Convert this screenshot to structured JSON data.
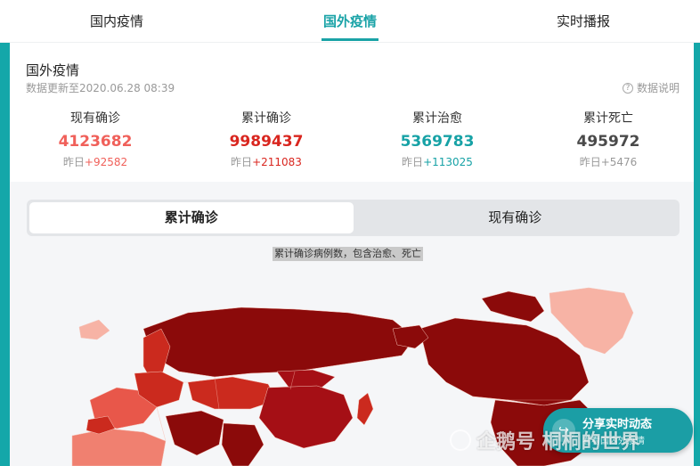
{
  "tabs": [
    {
      "label": "国内疫情",
      "active": false
    },
    {
      "label": "国外疫情",
      "active": true
    },
    {
      "label": "实时播报",
      "active": false
    }
  ],
  "header": {
    "title": "国外疫情",
    "update": "数据更新至2020.06.28 08:39",
    "help_label": "数据说明",
    "help_icon": "question-circle-icon"
  },
  "stats": [
    {
      "label": "现有确诊",
      "value": "4123682",
      "delta_prefix": "昨日",
      "delta": "+92582",
      "color": "#f0605a"
    },
    {
      "label": "累计确诊",
      "value": "9989437",
      "delta_prefix": "昨日",
      "delta": "+211083",
      "color": "#d9261f"
    },
    {
      "label": "累计治愈",
      "value": "5369783",
      "delta_prefix": "昨日",
      "delta": "+113025",
      "color": "#17a2a6"
    },
    {
      "label": "累计死亡",
      "value": "495972",
      "delta_prefix": "昨日",
      "delta": "+5476",
      "color": "#4a4a4a"
    }
  ],
  "toggle": {
    "options": [
      "累计确诊",
      "现有确诊"
    ],
    "selected": "累计确诊"
  },
  "map": {
    "caption": "累计确诊病例数，包含治愈、死亡",
    "colors": {
      "darkest": "#8b0a0a",
      "dark": "#a50f15",
      "mid": "#cb2a1e",
      "light": "#e8574a",
      "lighter": "#f08070",
      "pale": "#f7b3a5"
    }
  },
  "share": {
    "label": "分享实时动态",
    "sub": "看看国内外疫情",
    "icon": "share-icon"
  },
  "watermark": {
    "text": "企鹅号 桐桐的世界"
  }
}
